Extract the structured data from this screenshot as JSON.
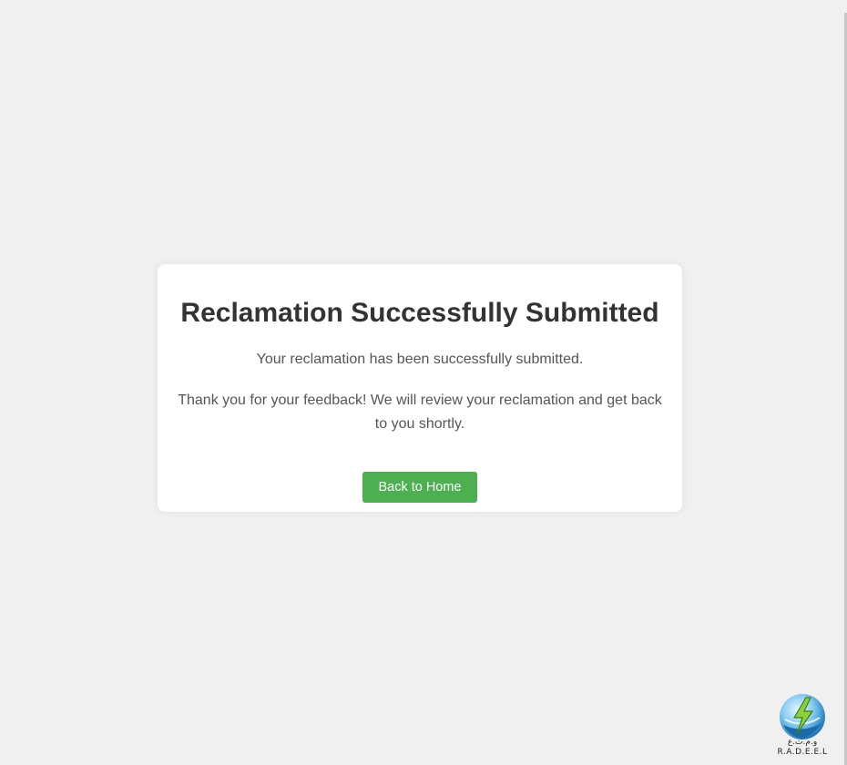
{
  "card": {
    "title": "Reclamation Successfully Submitted",
    "message_primary": "Your reclamation has been successfully submitted.",
    "message_secondary": "Thank you for your feedback! We will review your reclamation and get back to you shortly.",
    "home_button_label": "Back to Home"
  },
  "logo": {
    "arabic_text": "و.م.ت.ع",
    "latin_text": "R.A.D.E.E.L",
    "icon": "lightning-bolt-globe-icon"
  },
  "colors": {
    "page_background": "#f0f0f0",
    "card_background": "#ffffff",
    "title": "#333333",
    "body_text": "#555555",
    "button": "#4caf50",
    "button_text": "#ffffff"
  }
}
